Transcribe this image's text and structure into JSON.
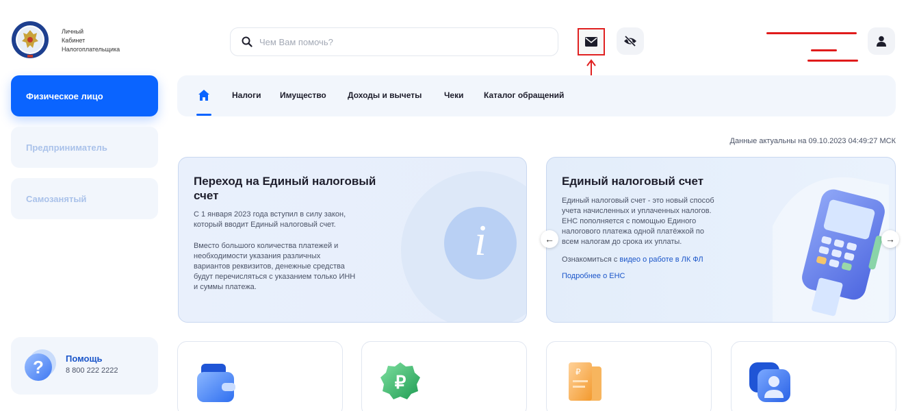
{
  "header": {
    "logo_lines": [
      "Личный",
      "Кабинет",
      "Налогоплательщика"
    ],
    "search_placeholder": "Чем Вам помочь?"
  },
  "sidebar": {
    "items": [
      {
        "label": "Физическое лицо",
        "active": true
      },
      {
        "label": "Предприниматель",
        "active": false
      },
      {
        "label": "Самозанятый",
        "active": false
      }
    ],
    "help": {
      "title": "Помощь",
      "phone": "8 800 222 2222"
    }
  },
  "nav": {
    "items": [
      "Налоги",
      "Имущество",
      "Доходы и вычеты",
      "Чеки",
      "Каталог обращений"
    ]
  },
  "updated_text": "Данные актуальны на 09.10.2023 04:49:27 МСК",
  "banner_left": {
    "title": "Переход на Единый налоговый счет",
    "p1": [
      "С 1 января 2023 года вступил в силу закон,",
      "который вводит Единый налоговый счет."
    ],
    "p2": [
      "Вместо большого количества платежей и",
      "необходимости указания различных",
      "вариантов реквизитов, денежные средства",
      "будут перечисляться с указанием только ИНН",
      "и суммы платежа."
    ],
    "icon_letter": "i"
  },
  "banner_right": {
    "title": "Единый налоговый счет",
    "p1": [
      "Единый налоговый счет - это новый способ",
      "учета начисленных и уплаченных налогов.",
      "ЕНС пополняется с помощью Единого",
      "налогового платежа одной платёжкой по",
      "всем налогам до срока их уплаты."
    ],
    "intro_prefix": "Ознакомиться с ",
    "video_link": "видео о работе в ЛК ФЛ",
    "more_link": "Подробнее о ЕНС"
  },
  "carousel": {
    "prev": "←",
    "next": "→"
  },
  "colors": {
    "primary": "#0a64ff",
    "annotation_red": "#e02020",
    "link": "#1a55c9"
  }
}
